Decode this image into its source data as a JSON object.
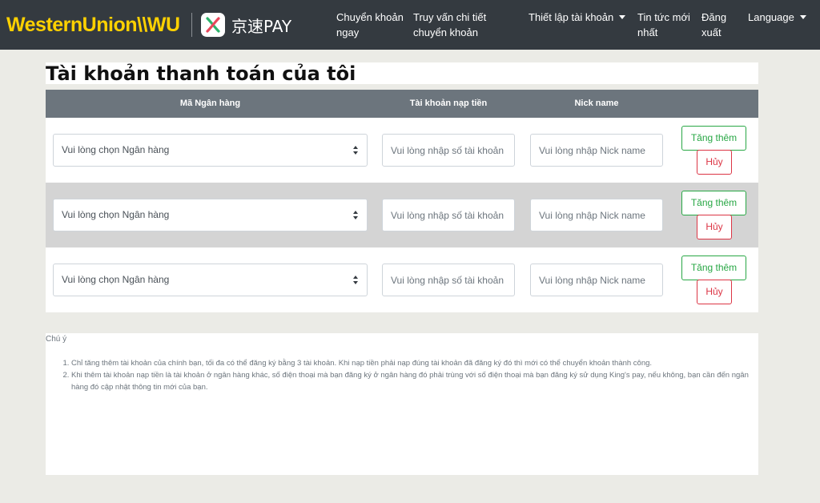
{
  "brand": {
    "wu_logo_text": "WesternUnion\\\\WU",
    "pay_logo_text": "京速PAY"
  },
  "nav": {
    "transfer_now": "Chuyển khoản ngay",
    "transfer_details": "Truy vấn chi tiết chuyển khoản",
    "account_settings": "Thiết lập tài khoản",
    "latest_news": "Tin tức mới nhất",
    "logout": "Đăng xuất",
    "language": "Language"
  },
  "page": {
    "title": "Tài khoản thanh toán của tôi"
  },
  "table": {
    "headers": {
      "bank_code": "Mã Ngân hàng",
      "deposit_account": "Tài khoản nạp tiền",
      "nick_name": "Nick name"
    },
    "rows": [
      {
        "bank_select": "Vui lòng chọn Ngân hàng",
        "account_placeholder": "Vui lòng nhập số tài khoản",
        "nick_placeholder": "Vui lòng nhập Nick name",
        "add_label": "Tăng thêm",
        "cancel_label": "Hủy"
      },
      {
        "bank_select": "Vui lòng chọn Ngân hàng",
        "account_placeholder": "Vui lòng nhập số tài khoản",
        "nick_placeholder": "Vui lòng nhập Nick name",
        "add_label": "Tăng thêm",
        "cancel_label": "Hủy"
      },
      {
        "bank_select": "Vui lòng chọn Ngân hàng",
        "account_placeholder": "Vui lòng nhập số tài khoản",
        "nick_placeholder": "Vui lòng nhập Nick name",
        "add_label": "Tăng thêm",
        "cancel_label": "Hủy"
      }
    ]
  },
  "note": {
    "title": "Chú ý",
    "items": [
      "Chỉ tăng thêm tài khoản của chính bạn, tối đa có thể đăng ký bằng 3 tài khoản. Khi nạp tiền phải nạp đúng tài khoản đã đăng ký đó thì mới có thể chuyển khoản thành công.",
      "Khi thêm tài khoản nạp tiền là tài khoản ở ngân hàng khác, số điện thoại mà bạn đăng ký ở ngân hàng đó phải trùng với số điện thoại mà bạn đăng ký sử dụng King's pay, nếu không, bạn cần đến ngân hàng đó cập nhật thông tin mới của bạn."
    ]
  },
  "colors": {
    "navbar_bg": "#343a40",
    "wu_yellow": "#ffd100",
    "table_head_bg": "#6c757d",
    "success": "#28a745",
    "danger": "#dc3545",
    "page_bg": "#ebebe6",
    "alt_row_bg": "#d4d4d4"
  }
}
